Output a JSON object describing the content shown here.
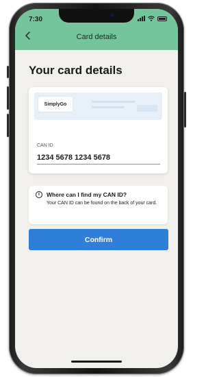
{
  "status_bar": {
    "time": "7:30"
  },
  "header": {
    "title": "Card details"
  },
  "page": {
    "title": "Your card details"
  },
  "card": {
    "logo_text": "SimplyGo",
    "can_label": "CAN ID",
    "can_value": "1234 5678 1234 5678"
  },
  "info": {
    "title": "Where can I find my CAN ID?",
    "body": "Your CAN ID can be found on the back of your card."
  },
  "actions": {
    "confirm_label": "Confirm"
  },
  "colors": {
    "header_bg": "#74c59b",
    "primary_button": "#2f7fd9",
    "input_underline": "#4cb47d",
    "screen_bg": "#f2f0ec"
  },
  "icons": [
    "back-chevron-icon",
    "info-icon",
    "signal-icon",
    "wifi-icon",
    "battery-icon"
  ]
}
